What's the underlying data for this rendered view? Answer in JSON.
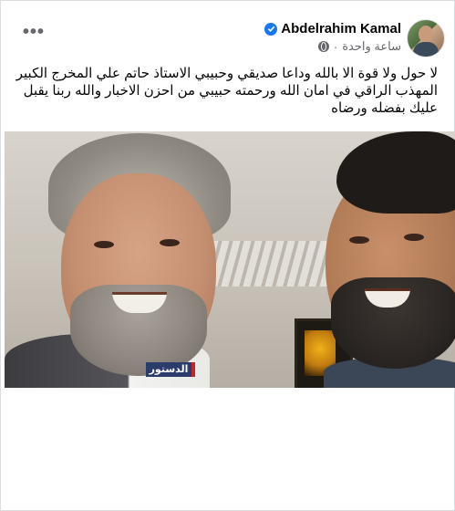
{
  "post": {
    "author": "Abdelrahim Kamal",
    "timestamp": "ساعة واحدة",
    "separator": "·",
    "more_label": "•••",
    "text": "لا حول ولا قوة الا بالله وداعا صديقي وحبيبي الاستاذ حاتم علي المخرج الكبير المهذب الراقي في امان الله ورحمته حبيبي من احزن الاخبار والله ربنا يقبل عليك بفضله ورضاه"
  },
  "photo": {
    "watermark": "الدستور"
  },
  "colors": {
    "verified": "#1877f2",
    "meta_text": "#65676b",
    "text": "#050505"
  },
  "icons": {
    "verified": "verified-badge-icon",
    "privacy": "globe-icon",
    "menu": "more-options-icon"
  }
}
